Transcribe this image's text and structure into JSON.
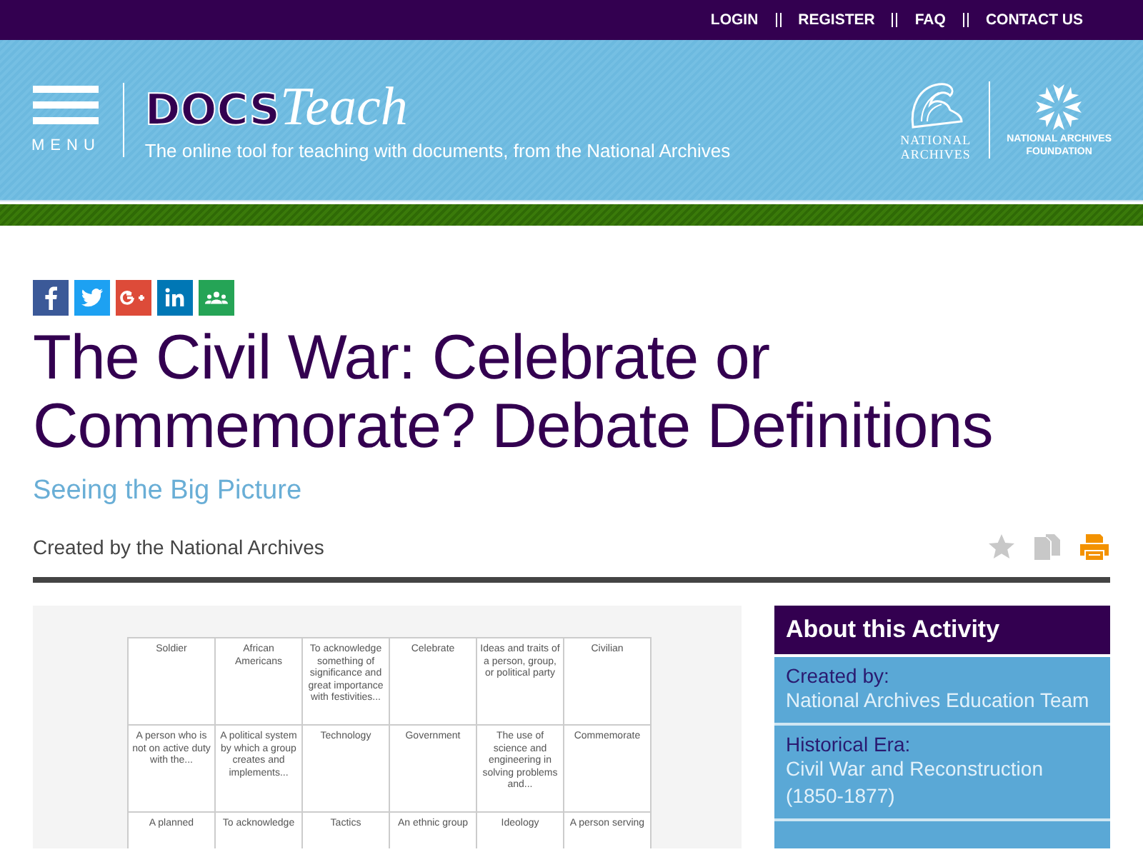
{
  "top_links": [
    "LOGIN",
    "REGISTER",
    "FAQ",
    "CONTACT US"
  ],
  "header": {
    "menu_label": "MENU",
    "logo_bold": "DOCS",
    "logo_italic": "Teach",
    "tagline": "The online tool for teaching with documents, from the National Archives",
    "partner_1": [
      "NATIONAL",
      "ARCHIVES"
    ],
    "partner_2": [
      "NATIONAL ARCHIVES",
      "FOUNDATION"
    ]
  },
  "share_buttons": [
    {
      "kind": "facebook",
      "color": "#3b5998"
    },
    {
      "kind": "twitter",
      "color": "#1da1f2"
    },
    {
      "kind": "google",
      "color": "#dd4b39"
    },
    {
      "kind": "linkedin",
      "color": "#0077b5"
    },
    {
      "kind": "classroom",
      "color": "#25a456"
    }
  ],
  "title": "The Civil War: Celebrate or Commemorate? Debate Definitions",
  "subtitle": "Seeing the Big Picture",
  "created_by": "Created by the National Archives",
  "actions": [
    {
      "kind": "favorite"
    },
    {
      "kind": "copy"
    },
    {
      "kind": "print"
    }
  ],
  "activity_grid": [
    [
      "Soldier",
      "African Americans",
      "To acknowledge something of significance and great importance with festivities...",
      "Celebrate",
      "Ideas and traits of a person, group, or political party",
      "Civilian"
    ],
    [
      "A person who is not on active duty with the...",
      "A political system by which a group creates and implements...",
      "Technology",
      "Government",
      "The use of science and engineering in solving problems and...",
      "Commemorate"
    ],
    [
      "A planned",
      "To acknowledge",
      "Tactics",
      "An ethnic group",
      "Ideology",
      "A person serving"
    ]
  ],
  "about": {
    "heading": "About this Activity",
    "fields": [
      {
        "label": "Created by:",
        "value": "National Archives Education Team"
      },
      {
        "label": "Historical Era:",
        "value": "Civil War and Reconstruction (1850-1877)"
      }
    ]
  }
}
